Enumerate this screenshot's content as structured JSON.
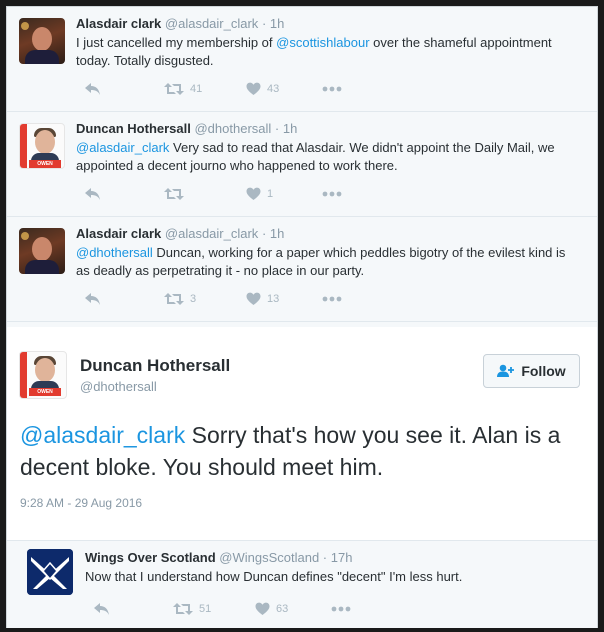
{
  "tweets": [
    {
      "name": "Alasdair clark",
      "handle": "@alasdair_clark",
      "time": "· 1h",
      "mention": "",
      "text": "I just cancelled my membership of ",
      "mention_inline": "@scottishlabour",
      "text_after": " over the shameful appointment today. Totally disgusted.",
      "retweets": "41",
      "likes": "43"
    },
    {
      "name": "Duncan Hothersall",
      "handle": "@dhothersall",
      "time": "· 1h",
      "mention": "@alasdair_clark",
      "text": " Very sad to read that Alasdair. We didn't appoint the Daily Mail, we appointed a decent journo who happened to work there.",
      "retweets": "",
      "likes": "1"
    },
    {
      "name": "Alasdair clark",
      "handle": "@alasdair_clark",
      "time": "· 1h",
      "mention": "@dhothersall",
      "text": " Duncan, working for a paper which peddles bigotry of the evilest kind is as deadly as perpetrating it - no place in our party.",
      "retweets": "3",
      "likes": "13"
    }
  ],
  "expanded": {
    "name": "Duncan Hothersall",
    "handle": "@dhothersall",
    "follow_label": "Follow",
    "mention": "@alasdair_clark",
    "text": " Sorry that's how you see it. Alan is a decent bloke. You should meet him.",
    "timestamp": "9:28 AM - 29 Aug 2016"
  },
  "reply": {
    "name": "Wings Over Scotland",
    "handle": "@WingsScotland",
    "time": "· 17h",
    "text": "Now that I understand how Duncan defines \"decent\" I'm less hurt.",
    "retweets": "51",
    "likes": "63"
  },
  "avatar_tag": "OWEN SMITH",
  "colors": {
    "mention": "#1b95e0",
    "muted": "#8899a6",
    "icon": "#aab8c2",
    "background": "#f5f8fa"
  },
  "icons": [
    "reply-icon",
    "retweet-icon",
    "like-icon",
    "more-icon",
    "follow-user-icon"
  ]
}
